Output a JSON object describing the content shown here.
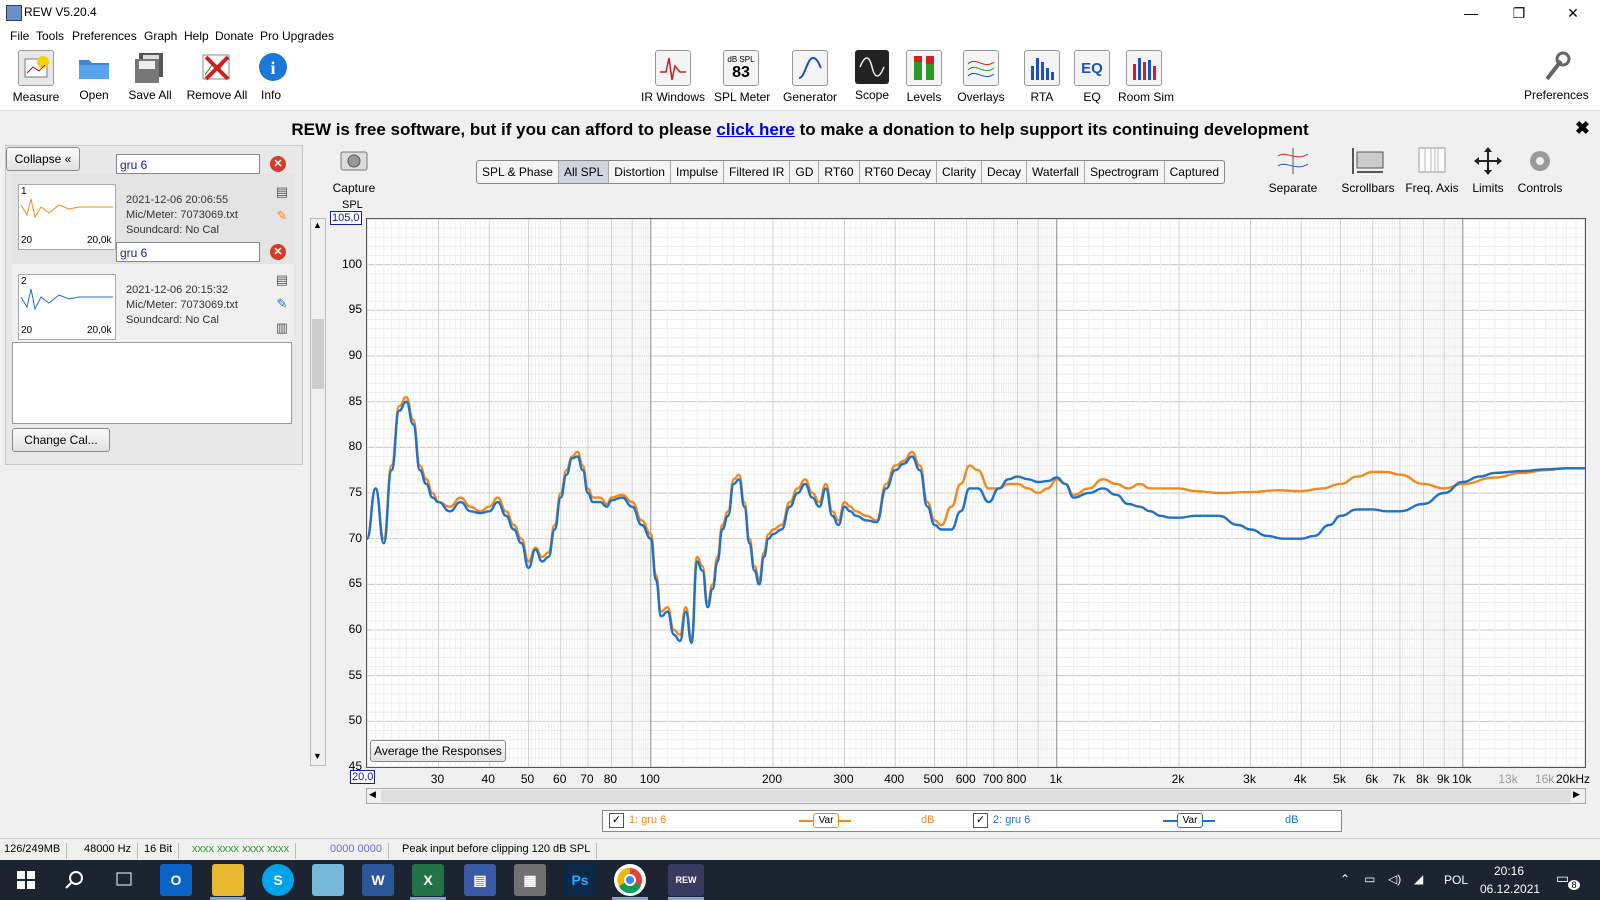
{
  "window": {
    "title": "REW V5.20.4",
    "controls": [
      "—",
      "❐",
      "✕"
    ]
  },
  "menu": [
    "File",
    "Tools",
    "Preferences",
    "Graph",
    "Help",
    "Donate",
    "Pro Upgrades"
  ],
  "toolbar": {
    "left": [
      "Measure",
      "Open",
      "Save All",
      "Remove All",
      "Info"
    ],
    "center": [
      "IR Windows",
      "SPL Meter",
      "Generator",
      "Scope",
      "Levels",
      "Overlays",
      "RTA",
      "EQ",
      "Room Sim"
    ],
    "spl_meter_unit": "dB SPL",
    "spl_meter_value": "83",
    "right": "Preferences"
  },
  "banner": {
    "before": "REW is free software, but if you can afford to please ",
    "link": "click here",
    "after": " to make a donation to help support its continuing development",
    "close": "✖"
  },
  "left_panel": {
    "collapse_label": "Collapse",
    "measurements": [
      {
        "index": "1",
        "name": "gru 6",
        "date": "2021-12-06 20:06:55",
        "mic": "Mic/Meter: 7073069.txt",
        "soundcard": "Soundcard: No Cal",
        "thumb_left": "20",
        "thumb_right": "20,0k",
        "color": "#f08a1e"
      },
      {
        "index": "2",
        "name": "gru 6",
        "date": "2021-12-06 20:15:32",
        "mic": "Mic/Meter: 7073069.txt",
        "soundcard": "Soundcard: No Cal",
        "thumb_left": "20",
        "thumb_right": "20,0k",
        "color": "#1f72c8"
      }
    ],
    "change_cal_label": "Change Cal..."
  },
  "graph": {
    "capture_label": "Capture",
    "tabs": [
      "SPL & Phase",
      "All SPL",
      "Distortion",
      "Impulse",
      "Filtered IR",
      "GD",
      "RT60",
      "RT60 Decay",
      "Clarity",
      "Decay",
      "Waterfall",
      "Spectrogram",
      "Captured"
    ],
    "active_tab": "All SPL",
    "right_tools": [
      "Separate",
      "Scrollbars",
      "Freq. Axis",
      "Limits",
      "Controls"
    ],
    "average_label": "Average the Responses"
  },
  "chart_data": {
    "type": "line",
    "ylabel": "SPL",
    "y_top_label": "105,0",
    "x_left_label": "20,0",
    "ylim": [
      45,
      105
    ],
    "xlim": [
      20,
      20000
    ],
    "x_scale": "log",
    "y_ticks": [
      "100",
      "95",
      "90",
      "85",
      "80",
      "75",
      "70",
      "65",
      "60",
      "55",
      "50",
      "45"
    ],
    "x_ticks": [
      {
        "f": 30,
        "label": "30"
      },
      {
        "f": 40,
        "label": "40"
      },
      {
        "f": 50,
        "label": "50"
      },
      {
        "f": 60,
        "label": "60"
      },
      {
        "f": 70,
        "label": "70"
      },
      {
        "f": 80,
        "label": "80"
      },
      {
        "f": 100,
        "label": "100"
      },
      {
        "f": 200,
        "label": "200"
      },
      {
        "f": 300,
        "label": "300"
      },
      {
        "f": 400,
        "label": "400"
      },
      {
        "f": 500,
        "label": "500"
      },
      {
        "f": 600,
        "label": "600"
      },
      {
        "f": 700,
        "label": "700"
      },
      {
        "f": 800,
        "label": "800"
      },
      {
        "f": 1000,
        "label": "1k"
      },
      {
        "f": 2000,
        "label": "2k"
      },
      {
        "f": 3000,
        "label": "3k"
      },
      {
        "f": 4000,
        "label": "4k"
      },
      {
        "f": 5000,
        "label": "5k"
      },
      {
        "f": 6000,
        "label": "6k"
      },
      {
        "f": 7000,
        "label": "7k"
      },
      {
        "f": 8000,
        "label": "8k"
      },
      {
        "f": 9000,
        "label": "9k"
      },
      {
        "f": 10000,
        "label": "10k"
      },
      {
        "f": 13000,
        "label": "13k"
      },
      {
        "f": 16000,
        "label": "16k"
      },
      {
        "f": 20000,
        "label": "20kHz"
      }
    ],
    "series": [
      {
        "name": "1: gru 6",
        "color": "#f08a1e",
        "points": [
          [
            20,
            70
          ],
          [
            21,
            75.5
          ],
          [
            22,
            70
          ],
          [
            23,
            78
          ],
          [
            24,
            84.5
          ],
          [
            25,
            85.5
          ],
          [
            26,
            83
          ],
          [
            27,
            78
          ],
          [
            28,
            76.5
          ],
          [
            29,
            75
          ],
          [
            30,
            74
          ],
          [
            32,
            73.5
          ],
          [
            34,
            74.5
          ],
          [
            36,
            73.5
          ],
          [
            38,
            73
          ],
          [
            40,
            73.5
          ],
          [
            42,
            74.5
          ],
          [
            44,
            73
          ],
          [
            46,
            71.5
          ],
          [
            48,
            70
          ],
          [
            50,
            67.5
          ],
          [
            52,
            69
          ],
          [
            54,
            68
          ],
          [
            56,
            68.5
          ],
          [
            58,
            71.5
          ],
          [
            60,
            75
          ],
          [
            62,
            77.5
          ],
          [
            64,
            79
          ],
          [
            66,
            79.5
          ],
          [
            68,
            78
          ],
          [
            70,
            75.5
          ],
          [
            72,
            74.5
          ],
          [
            75,
            74.5
          ],
          [
            78,
            73.8
          ],
          [
            80,
            74.5
          ],
          [
            85,
            74.8
          ],
          [
            90,
            74
          ],
          [
            95,
            72
          ],
          [
            100,
            70.5
          ],
          [
            103,
            66
          ],
          [
            106,
            62
          ],
          [
            110,
            62.5
          ],
          [
            114,
            60
          ],
          [
            118,
            59.5
          ],
          [
            122,
            62.5
          ],
          [
            126,
            59
          ],
          [
            130,
            68
          ],
          [
            134,
            67
          ],
          [
            138,
            63
          ],
          [
            142,
            65
          ],
          [
            146,
            68
          ],
          [
            150,
            71.5
          ],
          [
            155,
            73
          ],
          [
            160,
            76.5
          ],
          [
            165,
            77
          ],
          [
            170,
            74
          ],
          [
            175,
            70
          ],
          [
            180,
            67
          ],
          [
            185,
            65.5
          ],
          [
            190,
            68.5
          ],
          [
            195,
            70.5
          ],
          [
            200,
            71
          ],
          [
            210,
            71.5
          ],
          [
            220,
            74
          ],
          [
            230,
            75.5
          ],
          [
            240,
            76.5
          ],
          [
            250,
            75
          ],
          [
            260,
            74
          ],
          [
            270,
            76
          ],
          [
            280,
            73
          ],
          [
            290,
            72
          ],
          [
            300,
            74
          ],
          [
            310,
            73.5
          ],
          [
            320,
            73
          ],
          [
            340,
            72.5
          ],
          [
            360,
            72
          ],
          [
            380,
            76
          ],
          [
            400,
            78
          ],
          [
            420,
            78.5
          ],
          [
            440,
            79.5
          ],
          [
            460,
            78
          ],
          [
            480,
            74
          ],
          [
            500,
            72
          ],
          [
            520,
            71.5
          ],
          [
            550,
            73.5
          ],
          [
            580,
            76
          ],
          [
            610,
            78
          ],
          [
            640,
            77.5
          ],
          [
            680,
            75.5
          ],
          [
            720,
            75.5
          ],
          [
            760,
            76
          ],
          [
            800,
            76
          ],
          [
            850,
            75.5
          ],
          [
            900,
            75
          ],
          [
            950,
            75.5
          ],
          [
            1000,
            76.5
          ],
          [
            1050,
            76
          ],
          [
            1100,
            74.8
          ],
          [
            1200,
            75.5
          ],
          [
            1300,
            76.5
          ],
          [
            1400,
            76
          ],
          [
            1500,
            75.5
          ],
          [
            1600,
            76
          ],
          [
            1700,
            75.5
          ],
          [
            1800,
            75.5
          ],
          [
            1900,
            75.5
          ],
          [
            2000,
            75.5
          ],
          [
            2200,
            75.2
          ],
          [
            2500,
            75
          ],
          [
            3000,
            75.1
          ],
          [
            3500,
            75.3
          ],
          [
            4000,
            75.2
          ],
          [
            4500,
            75.5
          ],
          [
            5000,
            76
          ],
          [
            5500,
            76.8
          ],
          [
            6000,
            77.3
          ],
          [
            6500,
            77.3
          ],
          [
            7000,
            77
          ],
          [
            8000,
            76
          ],
          [
            9000,
            75.5
          ],
          [
            10000,
            76
          ],
          [
            12000,
            76.7
          ],
          [
            14000,
            77.2
          ],
          [
            16000,
            77.5
          ],
          [
            18000,
            77.7
          ],
          [
            20000,
            77.7
          ]
        ]
      },
      {
        "name": "2: gru 6",
        "color": "#1f72c8",
        "points": [
          [
            20,
            70
          ],
          [
            21,
            75.5
          ],
          [
            22,
            69.5
          ],
          [
            23,
            77.5
          ],
          [
            24,
            84
          ],
          [
            25,
            85
          ],
          [
            26,
            82.5
          ],
          [
            27,
            77.5
          ],
          [
            28,
            76
          ],
          [
            29,
            74.5
          ],
          [
            30,
            74
          ],
          [
            32,
            73
          ],
          [
            34,
            74
          ],
          [
            36,
            73
          ],
          [
            38,
            72.8
          ],
          [
            40,
            73
          ],
          [
            42,
            74
          ],
          [
            44,
            72.5
          ],
          [
            46,
            71
          ],
          [
            48,
            69.5
          ],
          [
            50,
            66.8
          ],
          [
            52,
            68.8
          ],
          [
            54,
            67.5
          ],
          [
            56,
            68
          ],
          [
            58,
            71
          ],
          [
            60,
            74.5
          ],
          [
            62,
            77
          ],
          [
            64,
            78.8
          ],
          [
            66,
            79
          ],
          [
            68,
            77.5
          ],
          [
            70,
            75
          ],
          [
            72,
            74
          ],
          [
            75,
            74
          ],
          [
            78,
            73.5
          ],
          [
            80,
            74.2
          ],
          [
            85,
            74.5
          ],
          [
            90,
            73.5
          ],
          [
            95,
            71.5
          ],
          [
            100,
            70
          ],
          [
            103,
            65.5
          ],
          [
            106,
            61.5
          ],
          [
            110,
            62
          ],
          [
            114,
            59.5
          ],
          [
            118,
            58.8
          ],
          [
            122,
            62
          ],
          [
            126,
            58.6
          ],
          [
            130,
            67.5
          ],
          [
            134,
            66.5
          ],
          [
            138,
            62.5
          ],
          [
            142,
            64.5
          ],
          [
            146,
            67.5
          ],
          [
            150,
            71
          ],
          [
            155,
            72.5
          ],
          [
            160,
            76
          ],
          [
            165,
            76.5
          ],
          [
            170,
            73.5
          ],
          [
            175,
            69.5
          ],
          [
            180,
            66.5
          ],
          [
            185,
            65
          ],
          [
            190,
            68
          ],
          [
            195,
            70
          ],
          [
            200,
            70.5
          ],
          [
            210,
            71
          ],
          [
            220,
            73.5
          ],
          [
            230,
            75
          ],
          [
            240,
            76
          ],
          [
            250,
            74.5
          ],
          [
            260,
            73.5
          ],
          [
            270,
            75.5
          ],
          [
            280,
            72.5
          ],
          [
            290,
            71.5
          ],
          [
            300,
            73.5
          ],
          [
            310,
            73
          ],
          [
            320,
            72.5
          ],
          [
            340,
            72
          ],
          [
            360,
            71.8
          ],
          [
            380,
            75.5
          ],
          [
            400,
            77.5
          ],
          [
            420,
            78.2
          ],
          [
            440,
            79
          ],
          [
            460,
            77.5
          ],
          [
            480,
            73.5
          ],
          [
            500,
            71.5
          ],
          [
            520,
            71
          ],
          [
            550,
            71
          ],
          [
            580,
            73
          ],
          [
            610,
            75.5
          ],
          [
            640,
            75.5
          ],
          [
            680,
            74
          ],
          [
            720,
            75.5
          ],
          [
            760,
            76.5
          ],
          [
            800,
            76.8
          ],
          [
            850,
            76.5
          ],
          [
            900,
            76.2
          ],
          [
            950,
            76.3
          ],
          [
            1000,
            76.7
          ],
          [
            1050,
            76
          ],
          [
            1100,
            74.5
          ],
          [
            1200,
            75
          ],
          [
            1300,
            75.5
          ],
          [
            1400,
            74.8
          ],
          [
            1500,
            73.8
          ],
          [
            1600,
            73.5
          ],
          [
            1700,
            73
          ],
          [
            1800,
            72.5
          ],
          [
            1900,
            72.3
          ],
          [
            2000,
            72.3
          ],
          [
            2200,
            72.5
          ],
          [
            2500,
            72.5
          ],
          [
            2800,
            71.5
          ],
          [
            3000,
            71
          ],
          [
            3300,
            70.3
          ],
          [
            3600,
            70
          ],
          [
            4000,
            70
          ],
          [
            4300,
            70.3
          ],
          [
            4700,
            71.5
          ],
          [
            5000,
            72.5
          ],
          [
            5500,
            73.2
          ],
          [
            6000,
            73.2
          ],
          [
            6500,
            73
          ],
          [
            7000,
            73
          ],
          [
            8000,
            73.8
          ],
          [
            9000,
            75
          ],
          [
            10000,
            76.2
          ],
          [
            11000,
            76.8
          ],
          [
            12000,
            77.2
          ],
          [
            14000,
            77.4
          ],
          [
            16000,
            77.6
          ],
          [
            18000,
            77.7
          ],
          [
            20000,
            77.7
          ]
        ]
      }
    ]
  },
  "legend": {
    "items": [
      {
        "label": "1: gru 6",
        "mode": "Var",
        "unit": "dB",
        "color": "#f08a1e"
      },
      {
        "label": "2: gru 6",
        "mode": "Var",
        "unit": "dB",
        "color": "#1f72c8"
      }
    ]
  },
  "status": {
    "memory": "126/249MB",
    "rate": "48000 Hz",
    "bits": "16 Bit",
    "meters1": "xxxx xxxx  xxxx xxxx",
    "meters2": "0000 0000",
    "message": "Peak input before clipping 120 dB SPL"
  },
  "taskbar": {
    "language": "POL",
    "time": "20:16",
    "date": "06.12.2021",
    "notifications": "8"
  }
}
